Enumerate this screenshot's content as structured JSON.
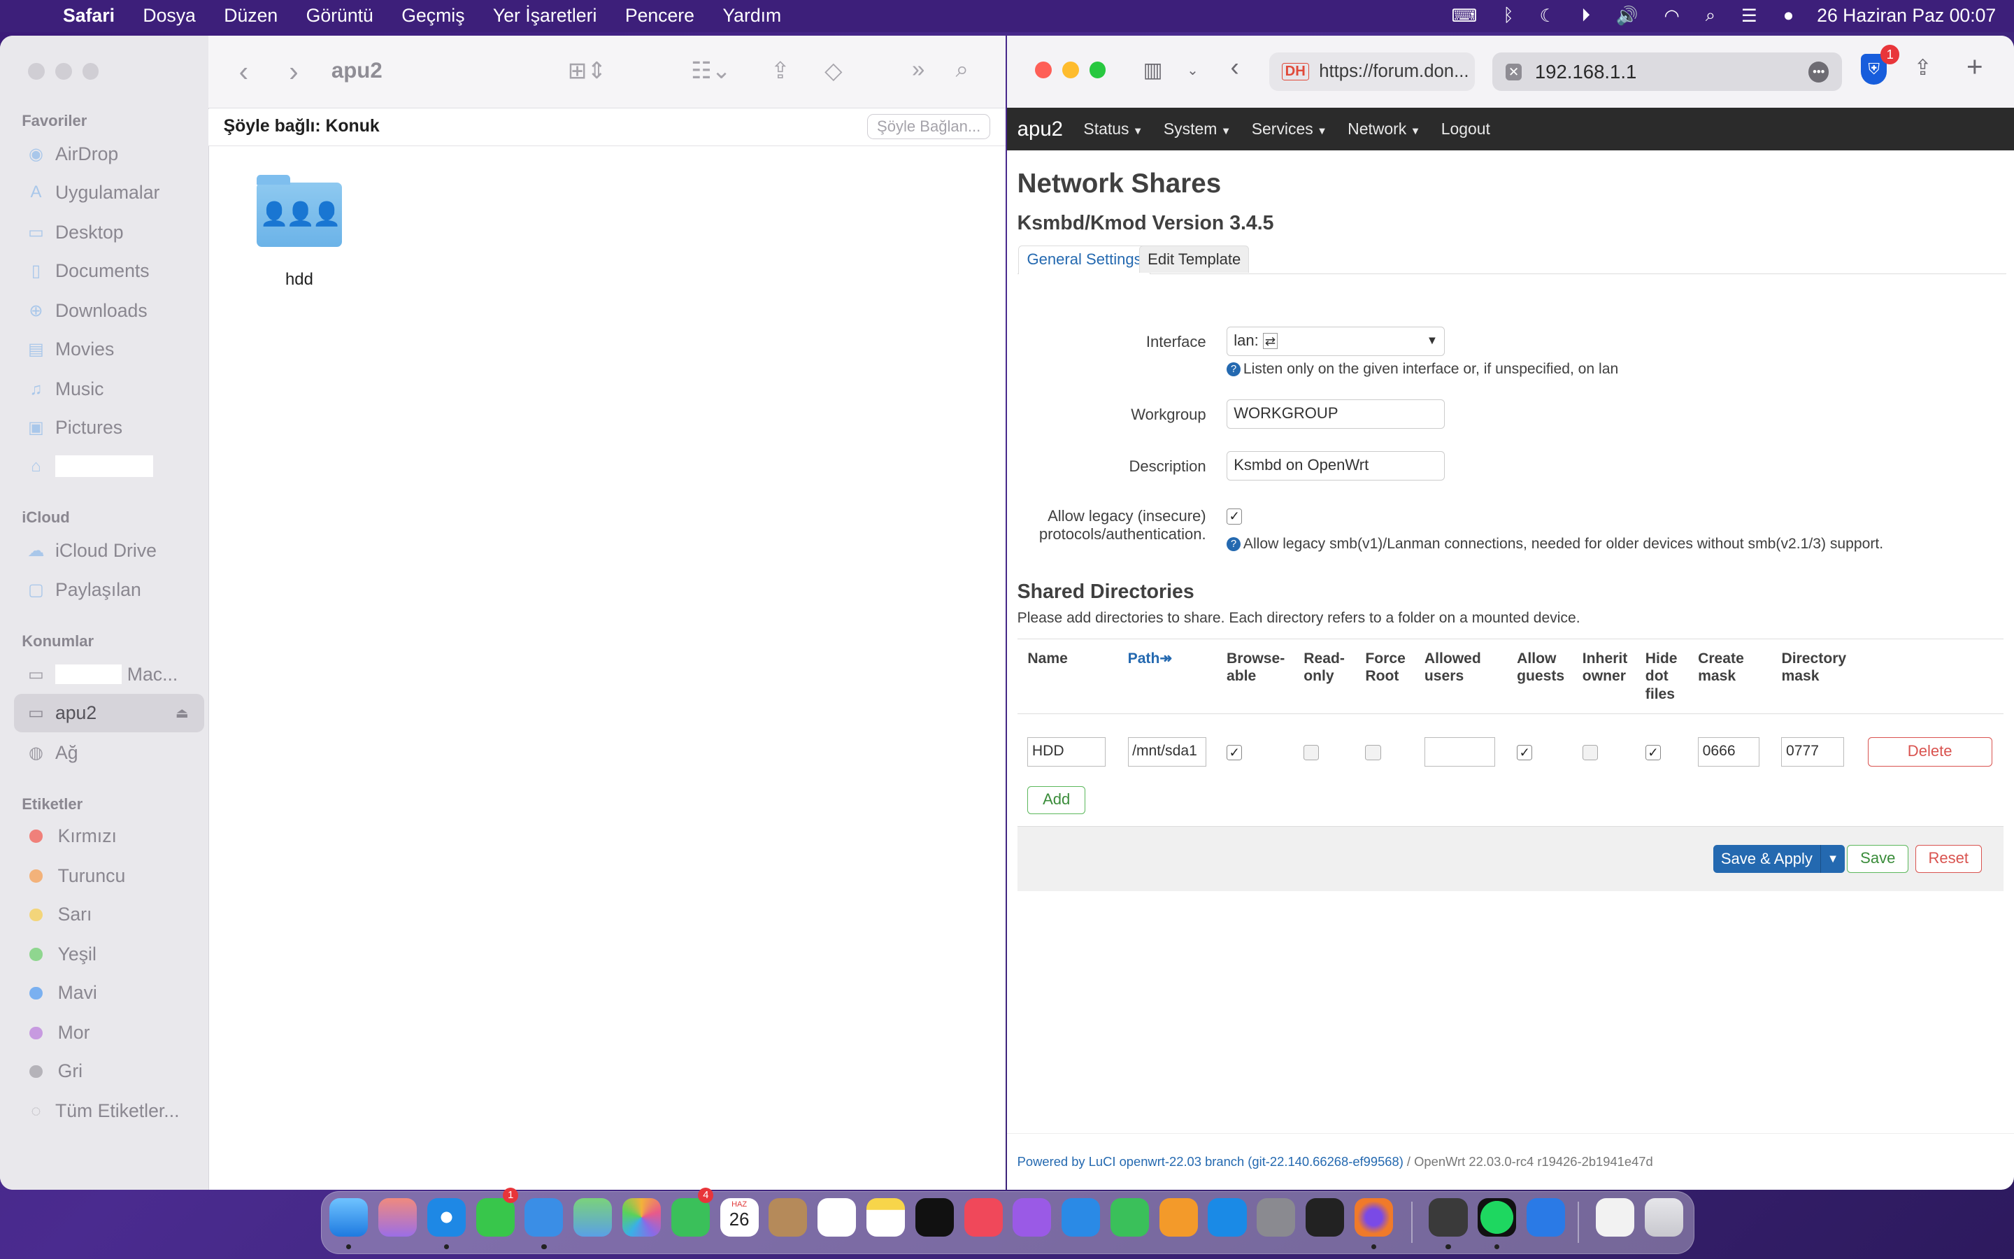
{
  "menubar": {
    "app": "Safari",
    "items": [
      "Dosya",
      "Düzen",
      "Görüntü",
      "Geçmiş",
      "Yer İşaretleri",
      "Pencere",
      "Yardım"
    ],
    "clock": "26 Haziran Paz  00:07"
  },
  "finder": {
    "title": "apu2",
    "connected_as": "Şöyle bağlı: Konuk",
    "connect_as_button": "Şöyle Bağlan...",
    "folder_name": "hdd",
    "sidebar": {
      "favorites_heading": "Favoriler",
      "favorites": [
        "AirDrop",
        "Uygulamalar",
        "Desktop",
        "Documents",
        "Downloads",
        "Movies",
        "Music",
        "Pictures"
      ],
      "icloud_heading": "iCloud",
      "icloud": [
        "iCloud Drive",
        "Paylaşılan"
      ],
      "locations_heading": "Konumlar",
      "locations": [
        "Mac...",
        "apu2",
        "Ağ"
      ],
      "tags_heading": "Etiketler",
      "tags": [
        {
          "name": "Kırmızı",
          "color": "#f0807a"
        },
        {
          "name": "Turuncu",
          "color": "#f3b27a"
        },
        {
          "name": "Sarı",
          "color": "#f3d57a"
        },
        {
          "name": "Yeşil",
          "color": "#8fd68f"
        },
        {
          "name": "Mavi",
          "color": "#7ab0f0"
        },
        {
          "name": "Mor",
          "color": "#c79ae0"
        },
        {
          "name": "Gri",
          "color": "#b5b3b9"
        }
      ],
      "all_tags": "Tüm Etiketler..."
    }
  },
  "safari": {
    "tab1": "https://forum.don...",
    "tab2": "192.168.1.1",
    "bitwarden_badge": "1"
  },
  "luci": {
    "brand": "apu2",
    "nav": [
      "Status",
      "System",
      "Services",
      "Network",
      "Logout"
    ],
    "page_title": "Network Shares",
    "subtitle": "Ksmbd/Kmod Version 3.4.5",
    "tabs": [
      "General Settings",
      "Edit Template"
    ],
    "interface": {
      "label": "Interface",
      "value": "lan:",
      "help": "Listen only on the given interface or, if unspecified, on lan"
    },
    "workgroup": {
      "label": "Workgroup",
      "value": "WORKGROUP"
    },
    "description": {
      "label": "Description",
      "value": "Ksmbd on OpenWrt"
    },
    "legacy": {
      "label_1": "Allow legacy (insecure)",
      "label_2": "protocols/authentication.",
      "checked": true,
      "help": "Allow legacy smb(v1)/Lanman connections, needed for older devices without smb(v2.1/3) support."
    },
    "shared_dirs_title": "Shared Directories",
    "shared_dirs_desc": "Please add directories to share. Each directory refers to a folder on a mounted device.",
    "columns": {
      "name": "Name",
      "path": "Path",
      "browseable_1": "Browse-",
      "browseable_2": "able",
      "readonly_1": "Read-",
      "readonly_2": "only",
      "forceroot_1": "Force",
      "forceroot_2": "Root",
      "allowedusers_1": "Allowed",
      "allowedusers_2": "users",
      "allowguests_1": "Allow",
      "allowguests_2": "guests",
      "inherit_1": "Inherit",
      "inherit_2": "owner",
      "hidedot_1": "Hide",
      "hidedot_2": "dot",
      "hidedot_3": "files",
      "createmask_1": "Create",
      "createmask_2": "mask",
      "dirmask_1": "Directory",
      "dirmask_2": "mask"
    },
    "row": {
      "name": "HDD",
      "path": "/mnt/sda1",
      "browseable": true,
      "readonly": false,
      "forceroot": false,
      "allowed_users": "",
      "allow_guests": true,
      "inherit_owner": false,
      "hide_dot_files": true,
      "create_mask": "0666",
      "dir_mask": "0777"
    },
    "delete_button": "Delete",
    "add_button": "Add",
    "save_apply_button": "Save & Apply",
    "save_button": "Save",
    "reset_button": "Reset",
    "footer_link": "Powered by LuCI openwrt-22.03 branch (git-22.140.66268-ef99568)",
    "footer_rest": " / OpenWrt 22.03.0-rc4 r19426-2b1941e47d"
  },
  "dock": {
    "calendar_month": "HAZ",
    "calendar_day": "26",
    "messages_badge": "1",
    "facetime_badge": "4"
  }
}
